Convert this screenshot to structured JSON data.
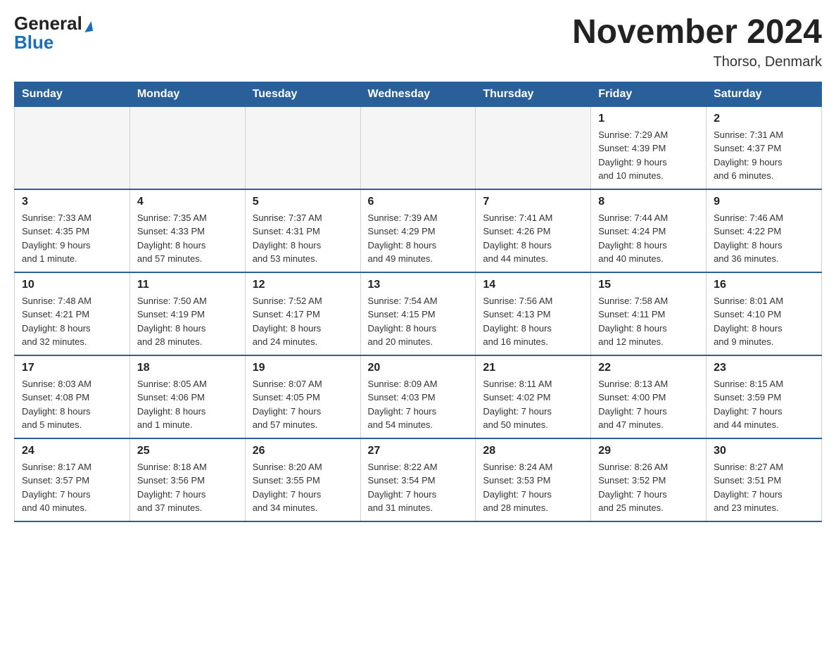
{
  "header": {
    "logo_general": "General",
    "logo_blue": "Blue",
    "month_title": "November 2024",
    "location": "Thorso, Denmark"
  },
  "weekdays": [
    "Sunday",
    "Monday",
    "Tuesday",
    "Wednesday",
    "Thursday",
    "Friday",
    "Saturday"
  ],
  "weeks": [
    [
      {
        "day": "",
        "info": ""
      },
      {
        "day": "",
        "info": ""
      },
      {
        "day": "",
        "info": ""
      },
      {
        "day": "",
        "info": ""
      },
      {
        "day": "",
        "info": ""
      },
      {
        "day": "1",
        "info": "Sunrise: 7:29 AM\nSunset: 4:39 PM\nDaylight: 9 hours\nand 10 minutes."
      },
      {
        "day": "2",
        "info": "Sunrise: 7:31 AM\nSunset: 4:37 PM\nDaylight: 9 hours\nand 6 minutes."
      }
    ],
    [
      {
        "day": "3",
        "info": "Sunrise: 7:33 AM\nSunset: 4:35 PM\nDaylight: 9 hours\nand 1 minute."
      },
      {
        "day": "4",
        "info": "Sunrise: 7:35 AM\nSunset: 4:33 PM\nDaylight: 8 hours\nand 57 minutes."
      },
      {
        "day": "5",
        "info": "Sunrise: 7:37 AM\nSunset: 4:31 PM\nDaylight: 8 hours\nand 53 minutes."
      },
      {
        "day": "6",
        "info": "Sunrise: 7:39 AM\nSunset: 4:29 PM\nDaylight: 8 hours\nand 49 minutes."
      },
      {
        "day": "7",
        "info": "Sunrise: 7:41 AM\nSunset: 4:26 PM\nDaylight: 8 hours\nand 44 minutes."
      },
      {
        "day": "8",
        "info": "Sunrise: 7:44 AM\nSunset: 4:24 PM\nDaylight: 8 hours\nand 40 minutes."
      },
      {
        "day": "9",
        "info": "Sunrise: 7:46 AM\nSunset: 4:22 PM\nDaylight: 8 hours\nand 36 minutes."
      }
    ],
    [
      {
        "day": "10",
        "info": "Sunrise: 7:48 AM\nSunset: 4:21 PM\nDaylight: 8 hours\nand 32 minutes."
      },
      {
        "day": "11",
        "info": "Sunrise: 7:50 AM\nSunset: 4:19 PM\nDaylight: 8 hours\nand 28 minutes."
      },
      {
        "day": "12",
        "info": "Sunrise: 7:52 AM\nSunset: 4:17 PM\nDaylight: 8 hours\nand 24 minutes."
      },
      {
        "day": "13",
        "info": "Sunrise: 7:54 AM\nSunset: 4:15 PM\nDaylight: 8 hours\nand 20 minutes."
      },
      {
        "day": "14",
        "info": "Sunrise: 7:56 AM\nSunset: 4:13 PM\nDaylight: 8 hours\nand 16 minutes."
      },
      {
        "day": "15",
        "info": "Sunrise: 7:58 AM\nSunset: 4:11 PM\nDaylight: 8 hours\nand 12 minutes."
      },
      {
        "day": "16",
        "info": "Sunrise: 8:01 AM\nSunset: 4:10 PM\nDaylight: 8 hours\nand 9 minutes."
      }
    ],
    [
      {
        "day": "17",
        "info": "Sunrise: 8:03 AM\nSunset: 4:08 PM\nDaylight: 8 hours\nand 5 minutes."
      },
      {
        "day": "18",
        "info": "Sunrise: 8:05 AM\nSunset: 4:06 PM\nDaylight: 8 hours\nand 1 minute."
      },
      {
        "day": "19",
        "info": "Sunrise: 8:07 AM\nSunset: 4:05 PM\nDaylight: 7 hours\nand 57 minutes."
      },
      {
        "day": "20",
        "info": "Sunrise: 8:09 AM\nSunset: 4:03 PM\nDaylight: 7 hours\nand 54 minutes."
      },
      {
        "day": "21",
        "info": "Sunrise: 8:11 AM\nSunset: 4:02 PM\nDaylight: 7 hours\nand 50 minutes."
      },
      {
        "day": "22",
        "info": "Sunrise: 8:13 AM\nSunset: 4:00 PM\nDaylight: 7 hours\nand 47 minutes."
      },
      {
        "day": "23",
        "info": "Sunrise: 8:15 AM\nSunset: 3:59 PM\nDaylight: 7 hours\nand 44 minutes."
      }
    ],
    [
      {
        "day": "24",
        "info": "Sunrise: 8:17 AM\nSunset: 3:57 PM\nDaylight: 7 hours\nand 40 minutes."
      },
      {
        "day": "25",
        "info": "Sunrise: 8:18 AM\nSunset: 3:56 PM\nDaylight: 7 hours\nand 37 minutes."
      },
      {
        "day": "26",
        "info": "Sunrise: 8:20 AM\nSunset: 3:55 PM\nDaylight: 7 hours\nand 34 minutes."
      },
      {
        "day": "27",
        "info": "Sunrise: 8:22 AM\nSunset: 3:54 PM\nDaylight: 7 hours\nand 31 minutes."
      },
      {
        "day": "28",
        "info": "Sunrise: 8:24 AM\nSunset: 3:53 PM\nDaylight: 7 hours\nand 28 minutes."
      },
      {
        "day": "29",
        "info": "Sunrise: 8:26 AM\nSunset: 3:52 PM\nDaylight: 7 hours\nand 25 minutes."
      },
      {
        "day": "30",
        "info": "Sunrise: 8:27 AM\nSunset: 3:51 PM\nDaylight: 7 hours\nand 23 minutes."
      }
    ]
  ]
}
